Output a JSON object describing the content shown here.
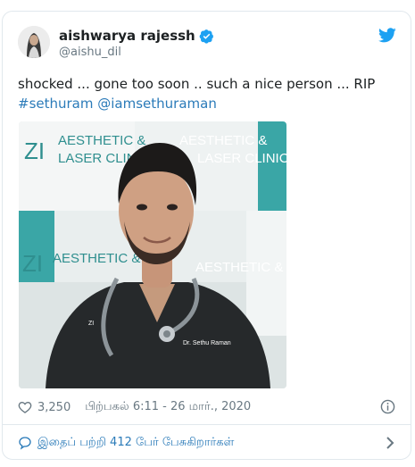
{
  "tweet": {
    "display_name": "aishwarya rajessh",
    "handle": "@aishu_dil",
    "text_plain": "shocked ... gone too soon .. such a nice person ... RIP",
    "hashtag": "#sethuram",
    "mention": "@iamsethuraman",
    "likes": "3,250",
    "timestamp": "பிற்பகல் 6:11 - 26 மார்., 2020",
    "replies_link": "இதைப் பற்றி 412 பேர் பேசுகிறார்கள்"
  },
  "photo": {
    "banner_text_1": "AESTHETIC &",
    "banner_text_2": "LASER CLINIC",
    "banner_logo": "ZI",
    "scrub_label": "Dr. Sethu Raman"
  },
  "colors": {
    "twitter_blue": "#1da1f2",
    "link_blue": "#2b7bb9",
    "muted": "#697882",
    "teal": "#2fa3a3"
  },
  "icons": [
    "verified-badge-icon",
    "twitter-bird-icon",
    "heart-icon",
    "info-icon",
    "speech-bubble-icon",
    "chevron-right-icon"
  ]
}
